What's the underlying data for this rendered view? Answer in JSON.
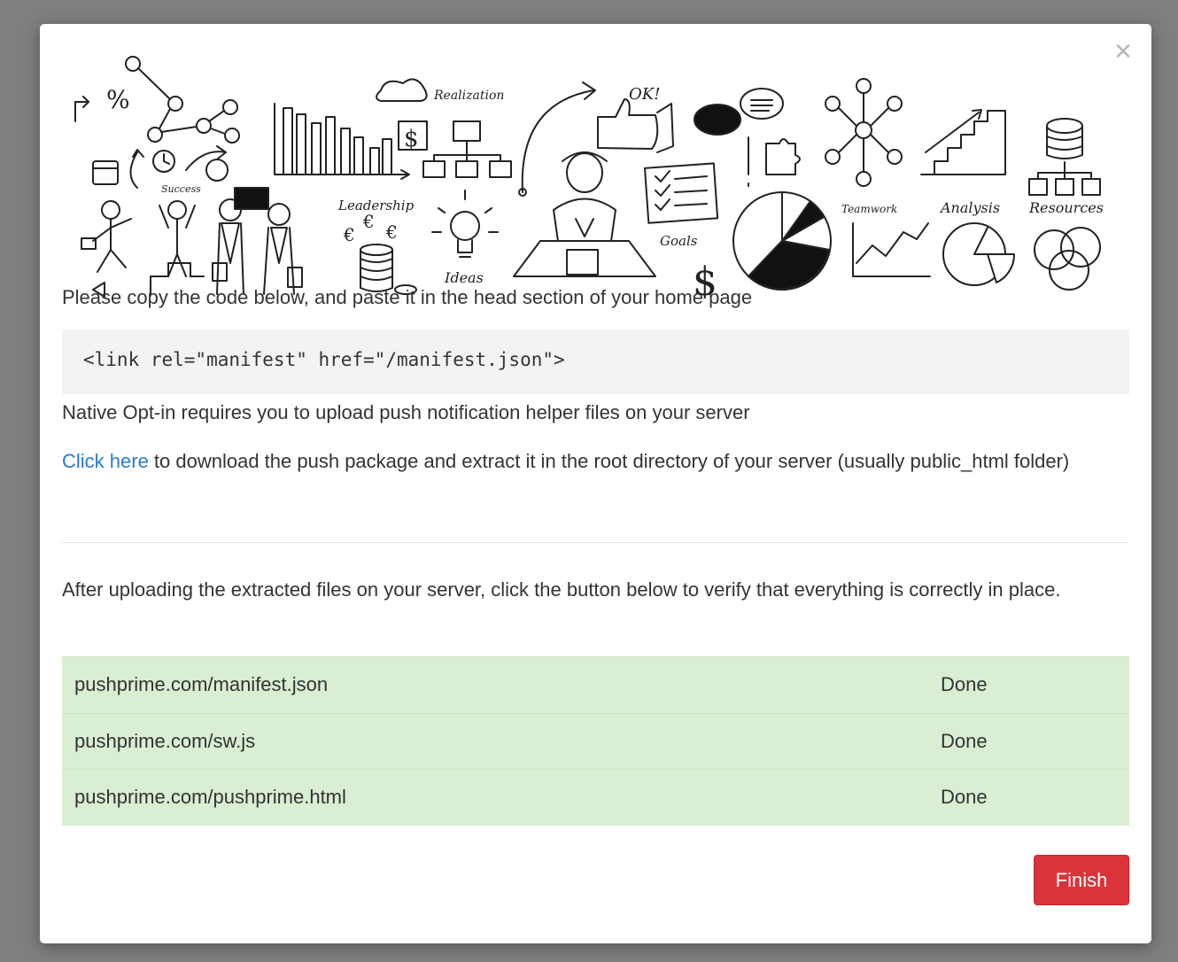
{
  "modal": {
    "close_glyph": "×",
    "banner_labels": {
      "realization": "Realization",
      "ok": "OK!",
      "success": "Success",
      "leadership": "Leadership",
      "ideas": "Ideas",
      "goals": "Goals",
      "teamwork": "Teamwork",
      "analysis": "Analysis",
      "resources": "Resources"
    },
    "instruction": "Please copy the code below, and paste it in the head section of your home page",
    "code_snippet": "<link rel=\"manifest\" href=\"/manifest.json\">",
    "native_optin_text": "Native Opt-in requires you to upload push notification helper files on your server",
    "download_link_label": "Click here",
    "download_text": " to download the push package and extract it in the root directory of your server (usually public_html folder)",
    "verify_text": "After uploading the extracted files on your server, click the button below to verify that everything is correctly in place.",
    "files": [
      {
        "url": "pushprime.com/manifest.json",
        "status": "Done"
      },
      {
        "url": "pushprime.com/sw.js",
        "status": "Done"
      },
      {
        "url": "pushprime.com/pushprime.html",
        "status": "Done"
      }
    ],
    "finish_label": "Finish"
  },
  "colors": {
    "success_row": "#d9eed2",
    "finish_button": "#d9343a",
    "link": "#2a7ad2"
  }
}
